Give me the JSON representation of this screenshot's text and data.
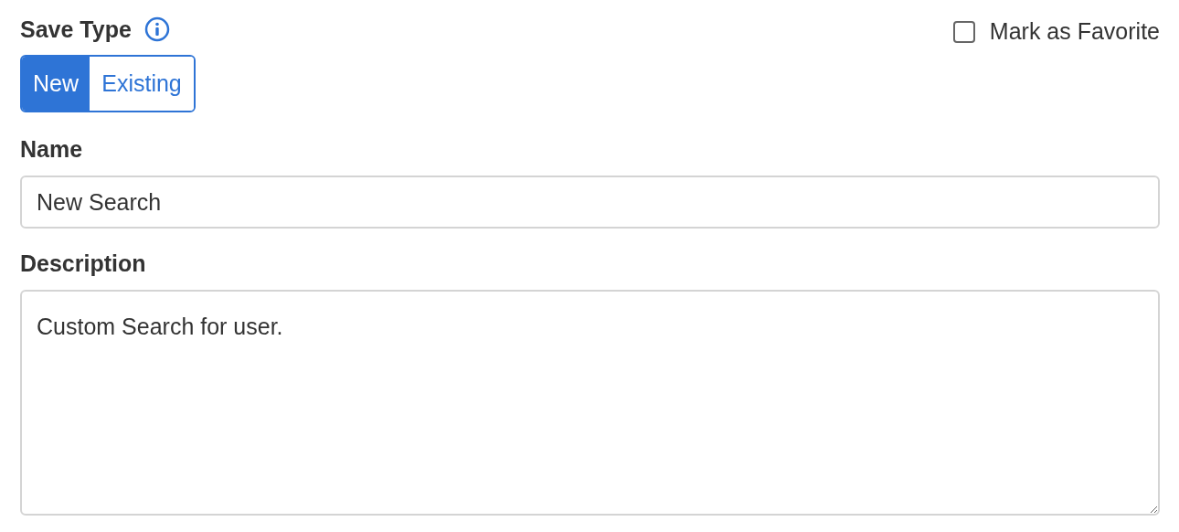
{
  "save_type": {
    "label": "Save Type",
    "options": [
      {
        "label": "New",
        "selected": true
      },
      {
        "label": "Existing",
        "selected": false
      }
    ]
  },
  "favorite": {
    "label": "Mark as Favorite",
    "checked": false
  },
  "name": {
    "label": "Name",
    "value": "New Search"
  },
  "description": {
    "label": "Description",
    "value": "Custom Search for user."
  }
}
